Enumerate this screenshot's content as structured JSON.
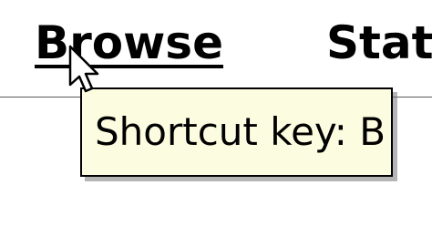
{
  "menu": {
    "items": [
      {
        "label": "Browse",
        "underlined": true
      },
      {
        "label": "Stats"
      }
    ]
  },
  "tooltip": {
    "text": "Shortcut key: B",
    "background_color": "#fcfde0"
  },
  "cursor": {
    "icon": "arrow-pointer-icon"
  }
}
